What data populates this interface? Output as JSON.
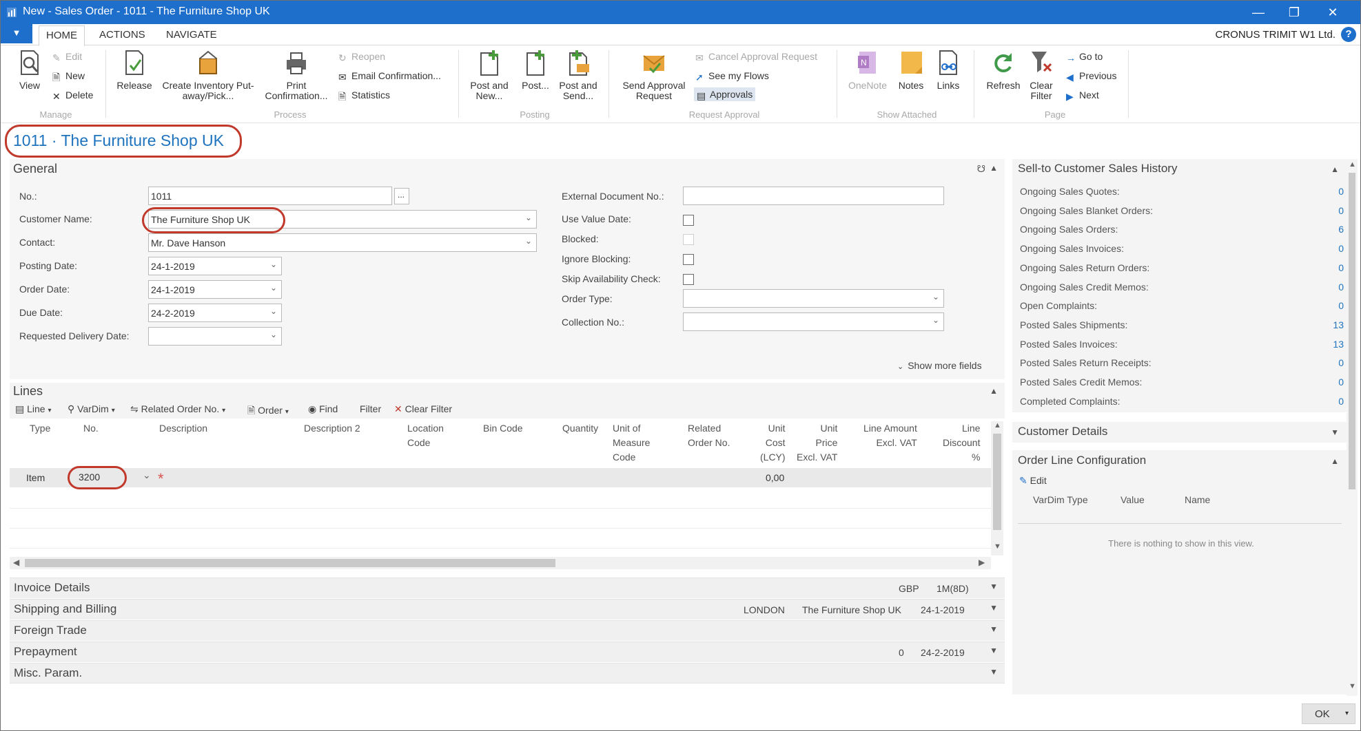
{
  "window": {
    "title": "New - Sales Order - 1011 - The Furniture Shop UK"
  },
  "tabs": [
    "HOME",
    "ACTIONS",
    "NAVIGATE"
  ],
  "company": "CRONUS TRIMIT W1 Ltd.",
  "ribbon": {
    "manage": {
      "view": "View",
      "edit": "Edit",
      "new": "New",
      "delete": "Delete",
      "group": "Manage"
    },
    "process": {
      "release": "Release",
      "create_inventory_1": "Create Inventory Put-",
      "create_inventory_2": "away/Pick...",
      "print_1": "Print",
      "print_2": "Confirmation...",
      "reopen": "Reopen",
      "email": "Email Confirmation...",
      "statistics": "Statistics",
      "group": "Process"
    },
    "posting": {
      "post_new_1": "Post and",
      "post_new_2": "New...",
      "post": "Post...",
      "post_send_1": "Post and",
      "post_send_2": "Send...",
      "group": "Posting"
    },
    "approval": {
      "send_1": "Send Approval",
      "send_2": "Request",
      "cancel": "Cancel Approval Request",
      "flows": "See my Flows",
      "approvals": "Approvals",
      "group": "Request Approval"
    },
    "attached": {
      "onenote": "OneNote",
      "notes": "Notes",
      "links": "Links",
      "group": "Show Attached"
    },
    "page": {
      "refresh": "Refresh",
      "clear_1": "Clear",
      "clear_2": "Filter",
      "goto": "Go to",
      "previous": "Previous",
      "next": "Next",
      "group": "Page"
    }
  },
  "page_title": "1011 · The Furniture Shop UK",
  "general": {
    "title": "General",
    "no_label": "No.:",
    "no_value": "1011",
    "no_btn": "...",
    "customer_label": "Customer Name:",
    "customer_value": "The Furniture Shop UK",
    "contact_label": "Contact:",
    "contact_value": "Mr. Dave Hanson",
    "posting_label": "Posting Date:",
    "posting_value": "24-1-2019",
    "order_label": "Order Date:",
    "order_value": "24-1-2019",
    "due_label": "Due Date:",
    "due_value": "24-2-2019",
    "req_label": "Requested Delivery Date:",
    "req_value": "",
    "ext_label": "External Document No.:",
    "ext_value": "",
    "use_value_label": "Use Value Date:",
    "blocked_label": "Blocked:",
    "ignore_label": "Ignore Blocking:",
    "skip_label": "Skip Availability Check:",
    "ordertype_label": "Order Type:",
    "ordertype_value": "",
    "collection_label": "Collection No.:",
    "collection_value": "",
    "show_more": "Show more fields"
  },
  "lines": {
    "title": "Lines",
    "toolbar": {
      "line": "Line",
      "vardim": "VarDim",
      "related": "Related Order No.",
      "order": "Order",
      "find": "Find",
      "filter": "Filter",
      "clear_filter": "Clear Filter"
    },
    "columns": {
      "type": "Type",
      "no": "No.",
      "description": "Description",
      "description2": "Description 2",
      "location_1": "Location",
      "location_2": "Code",
      "bin": "Bin Code",
      "quantity": "Quantity",
      "uom_1": "Unit of",
      "uom_2": "Measure",
      "uom_3": "Code",
      "related_1": "Related",
      "related_2": "Order No.",
      "unitcost_1": "Unit",
      "unitcost_2": "Cost",
      "unitcost_3": "(LCY)",
      "unitprice_1": "Unit",
      "unitprice_2": "Price",
      "unitprice_3": "Excl. VAT",
      "lineamount_1": "Line Amount",
      "lineamount_2": "Excl. VAT",
      "linedisc_1": "Line",
      "linedisc_2": "Discount",
      "linedisc_3": "%"
    },
    "row": {
      "type": "Item",
      "no": "3200",
      "unit_cost": "0,00",
      "required_mark": "*"
    }
  },
  "fasttabs": {
    "invoice": {
      "title": "Invoice Details",
      "v1": "GBP",
      "v2": "1M(8D)"
    },
    "shipping": {
      "title": "Shipping and Billing",
      "v1": "LONDON",
      "v2": "The Furniture Shop UK",
      "v3": "24-1-2019"
    },
    "foreign": {
      "title": "Foreign Trade"
    },
    "prepayment": {
      "title": "Prepayment",
      "v1": "0",
      "v2": "24-2-2019"
    },
    "misc": {
      "title": "Misc. Param."
    }
  },
  "factbox": {
    "history_title": "Sell-to Customer Sales History",
    "history": [
      {
        "label": "Ongoing Sales Quotes:",
        "value": "0"
      },
      {
        "label": "Ongoing Sales Blanket Orders:",
        "value": "0"
      },
      {
        "label": "Ongoing Sales Orders:",
        "value": "6"
      },
      {
        "label": "Ongoing Sales Invoices:",
        "value": "0"
      },
      {
        "label": "Ongoing Sales Return Orders:",
        "value": "0"
      },
      {
        "label": "Ongoing Sales Credit Memos:",
        "value": "0"
      },
      {
        "label": "Open Complaints:",
        "value": "0"
      },
      {
        "label": "Posted Sales Shipments:",
        "value": "13"
      },
      {
        "label": "Posted Sales Invoices:",
        "value": "13"
      },
      {
        "label": "Posted Sales Return Receipts:",
        "value": "0"
      },
      {
        "label": "Posted Sales Credit Memos:",
        "value": "0"
      },
      {
        "label": "Completed Complaints:",
        "value": "0"
      }
    ],
    "customer_details": "Customer Details",
    "olc_title": "Order Line Configuration",
    "olc_edit": "Edit",
    "olc_cols": {
      "vardim": "VarDim Type",
      "value": "Value",
      "name": "Name"
    },
    "olc_empty": "There is nothing to show in this view."
  },
  "ok_button": "OK",
  "colors": {
    "accent": "#1e6fcc",
    "link": "#1e73be",
    "annotation": "#c0392b"
  }
}
